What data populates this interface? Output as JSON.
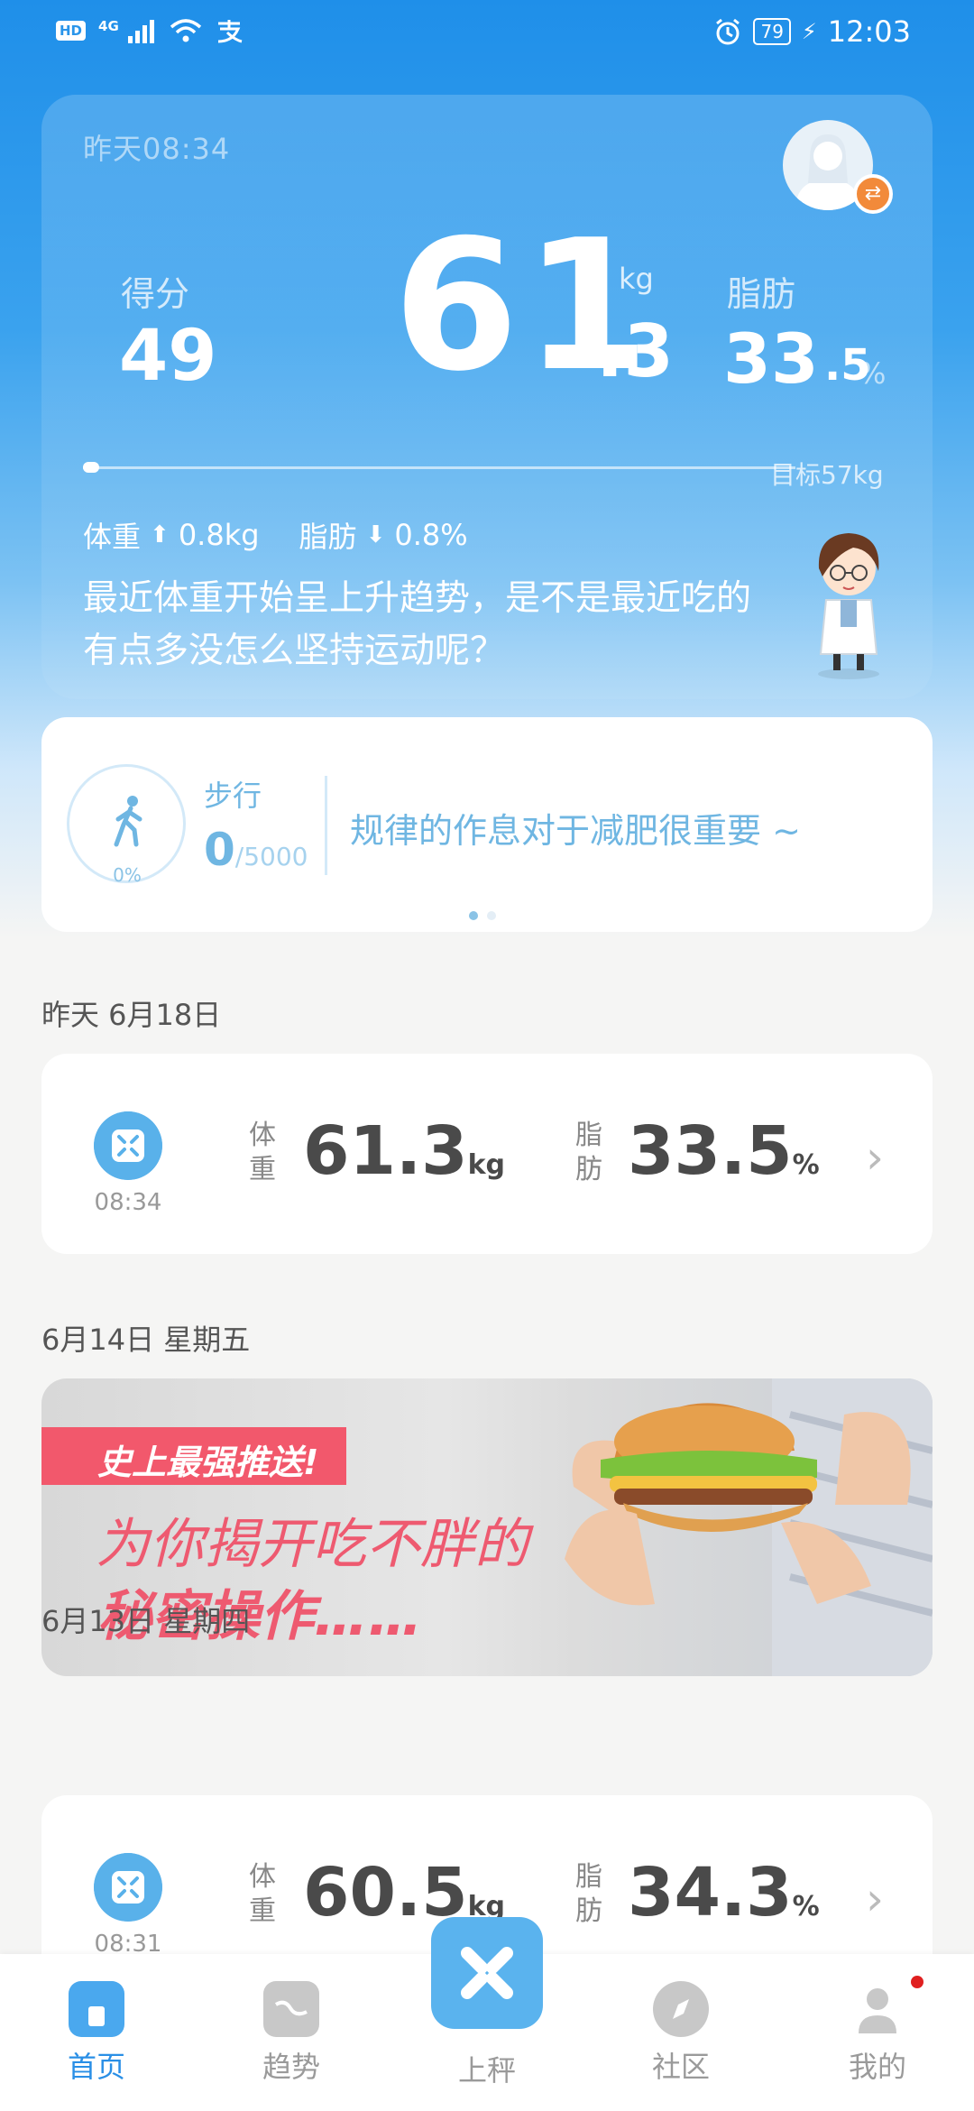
{
  "status_bar": {
    "hd": "HD",
    "network": "4G",
    "battery": "79",
    "time": "12:03"
  },
  "hero": {
    "measured_time": "昨天08:34",
    "score_label": "得分",
    "score_value": "49",
    "weight_int": "61",
    "weight_dec": ".3",
    "weight_unit": "kg",
    "fat_label": "脂肪",
    "fat_int": "33",
    "fat_dec": ".5",
    "fat_unit": "%",
    "goal": "目标57kg",
    "weight_change_label": "体重",
    "weight_change_value": "0.8kg",
    "fat_change_label": "脂肪",
    "fat_change_value": "0.8%",
    "advice": "最近体重开始呈上升趋势，是不是最近吃的有点多没怎么坚持运动呢？"
  },
  "steps": {
    "label": "步行",
    "value": "0",
    "goal": "/5000",
    "percent": "0%",
    "tip": "规律的作息对于减肥很重要 ~"
  },
  "records": [
    {
      "date": "昨天 6月18日",
      "time": "08:34",
      "weight_label": "体重",
      "weight": "61.3",
      "weight_unit": "kg",
      "fat_label": "脂肪",
      "fat": "33.5",
      "fat_unit": "%"
    },
    {
      "date": "6月13日  星期四",
      "time": "08:31",
      "weight_label": "体重",
      "weight": "60.5",
      "weight_unit": "kg",
      "fat_label": "脂肪",
      "fat": "34.3",
      "fat_unit": "%"
    }
  ],
  "banner": {
    "date": "6月14日  星期五",
    "tag": "史上最强推送!",
    "title_line1": "为你揭开吃不胖的",
    "title_line2": "秘密操作……"
  },
  "nav": {
    "home": "首页",
    "trend": "趋势",
    "weigh": "上秤",
    "community": "社区",
    "mine": "我的"
  },
  "colors": {
    "accent": "#2a8fe6",
    "tag_red": "#f2586c"
  }
}
